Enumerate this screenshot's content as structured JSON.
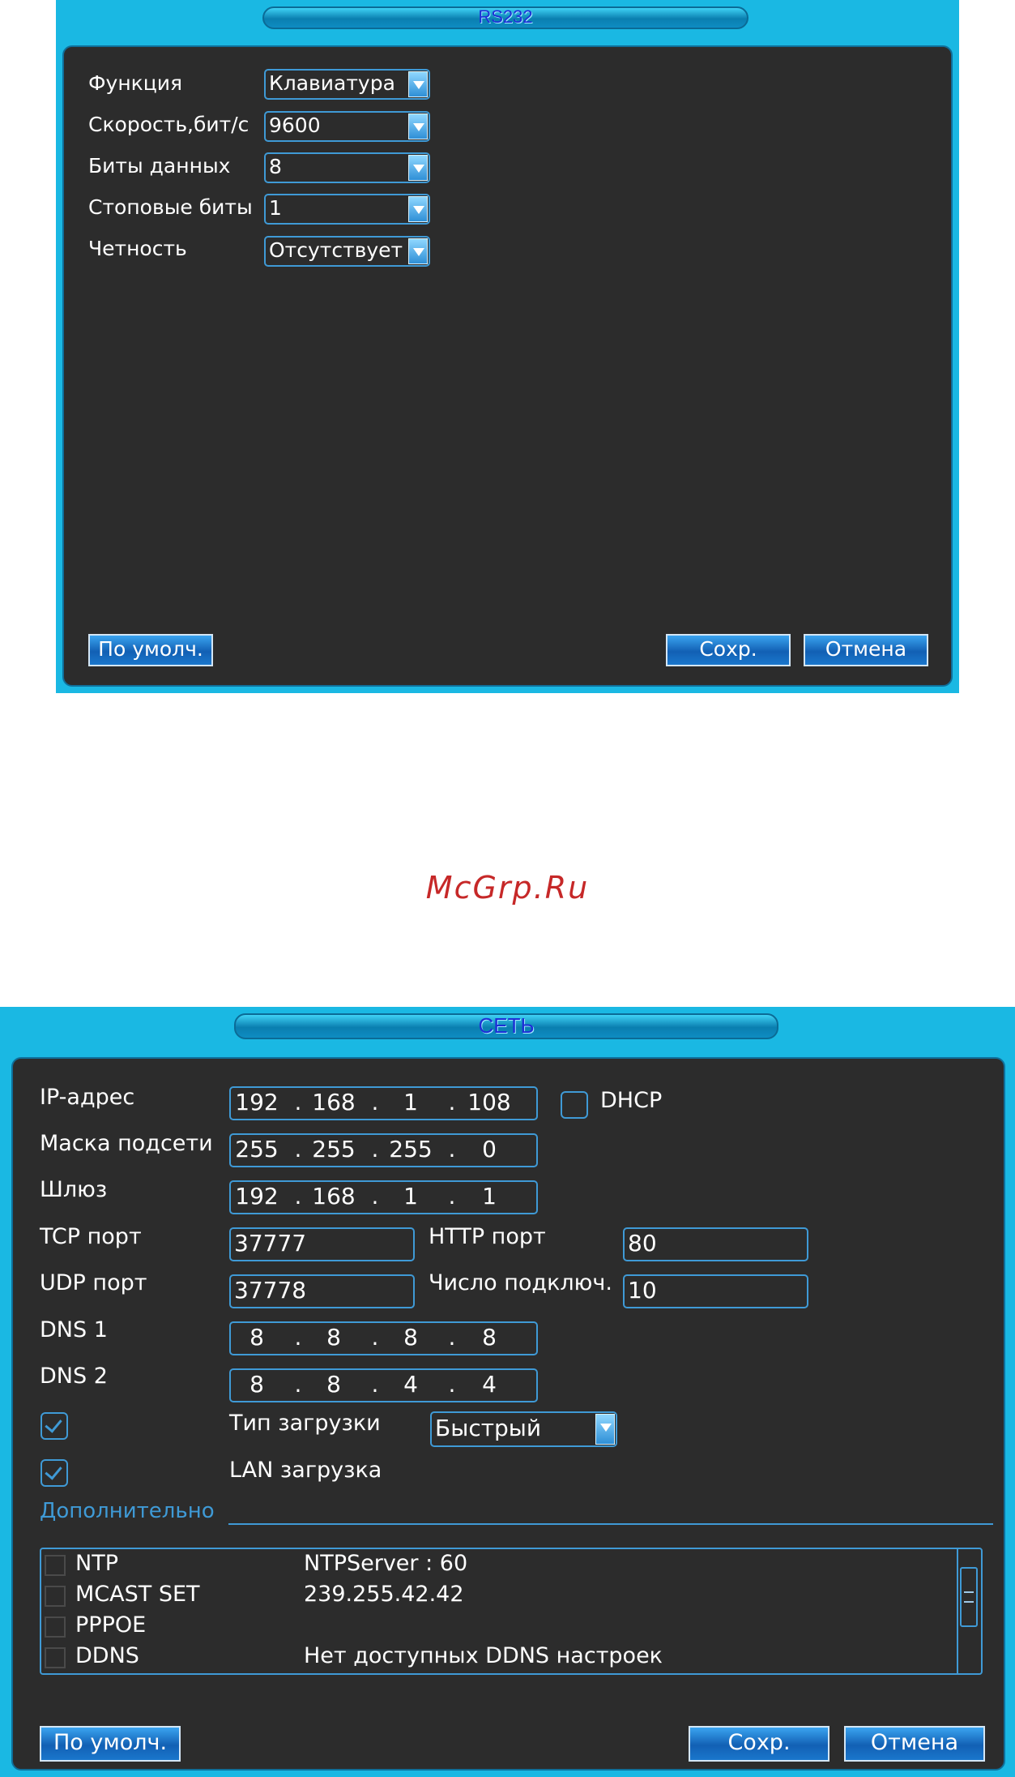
{
  "rs232": {
    "title": "RS232",
    "rows": [
      {
        "label": "Функция",
        "value": "Клавиатура"
      },
      {
        "label": "Скорость,бит/с",
        "value": "9600"
      },
      {
        "label": "Биты данных",
        "value": "8"
      },
      {
        "label": "Стоповые биты",
        "value": "1"
      },
      {
        "label": "Четность",
        "value": "Отсутствует"
      }
    ],
    "buttons": {
      "default": "По умолч.",
      "save": "Сохр.",
      "cancel": "Отмена"
    }
  },
  "watermark": "McGrp.Ru",
  "network": {
    "title": "СЕТЬ",
    "ip": {
      "label": "IP-адрес",
      "octets": [
        "192",
        "168",
        "1",
        "108"
      ]
    },
    "dhcp": {
      "label": "DHCP",
      "checked": false
    },
    "mask": {
      "label": "Маска подсети",
      "octets": [
        "255",
        "255",
        "255",
        "0"
      ]
    },
    "gateway": {
      "label": "Шлюз",
      "octets": [
        "192",
        "168",
        "1",
        "1"
      ]
    },
    "tcp": {
      "label": "TCP порт",
      "value": "37777"
    },
    "http": {
      "label": "HTTP порт",
      "value": "80"
    },
    "udp": {
      "label": "UDP порт",
      "value": "37778"
    },
    "connections": {
      "label": "Число подключ.",
      "value": "10"
    },
    "dns1": {
      "label": "DNS 1",
      "octets": [
        "8",
        "8",
        "8",
        "8"
      ]
    },
    "dns2": {
      "label": "DNS 2",
      "octets": [
        "8",
        "8",
        "4",
        "4"
      ]
    },
    "download_type": {
      "label": "Тип загрузки",
      "value": "Быстрый",
      "checked": true
    },
    "lan_download": {
      "label": "LAN загрузка",
      "checked": true
    },
    "advanced_label": "Дополнительно",
    "advanced_items": [
      {
        "name": "NTP",
        "value": "NTPServer : 60"
      },
      {
        "name": "MCAST SET",
        "value": "239.255.42.42"
      },
      {
        "name": "PPPOE",
        "value": ""
      },
      {
        "name": "DDNS",
        "value": "Нет доступных DDNS настроек"
      }
    ],
    "buttons": {
      "default": "По умолч.",
      "save": "Сохр.",
      "cancel": "Отмена"
    }
  }
}
